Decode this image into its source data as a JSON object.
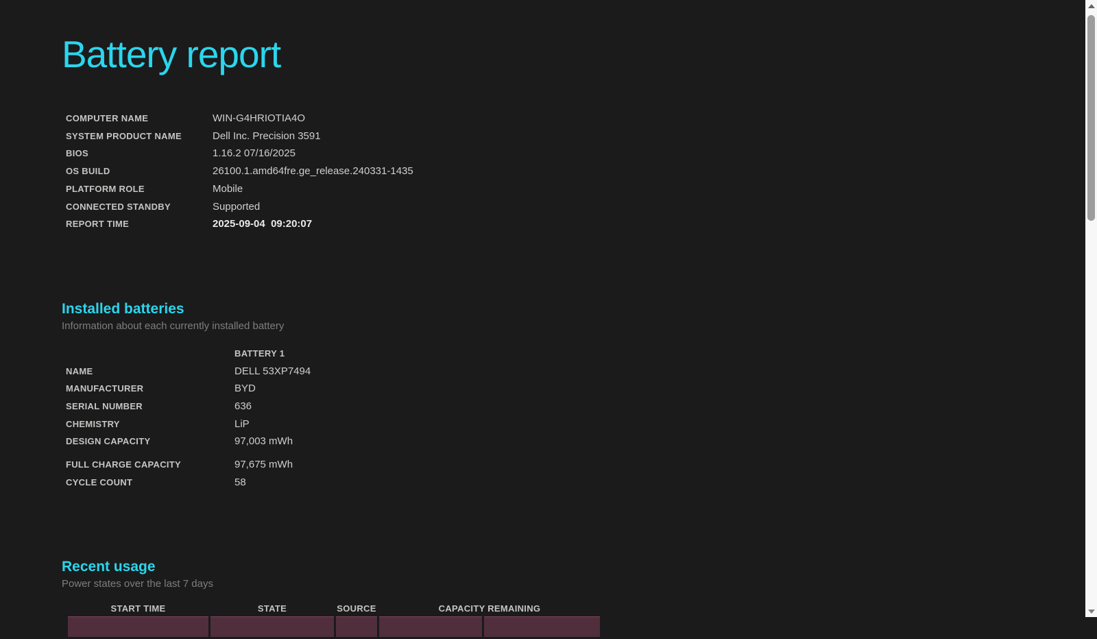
{
  "colors": {
    "background": "#1b1b1c",
    "accent": "#2bd6ed",
    "label_text": "#c6c5c2",
    "value_text": "#d0cfcc",
    "muted_text": "#7e7e7e",
    "usage_row_highlight": "#512e3b",
    "scrollbar_track": "#f7f7f7",
    "scrollbar_thumb": "#9d9d9d"
  },
  "title": "Battery report",
  "system_info": {
    "rows": [
      {
        "label": "COMPUTER NAME",
        "value": "WIN-G4HRIOTIA4O"
      },
      {
        "label": "SYSTEM PRODUCT NAME",
        "value": "Dell Inc. Precision 3591"
      },
      {
        "label": "BIOS",
        "value": "1.16.2 07/16/2025"
      },
      {
        "label": "OS BUILD",
        "value": "26100.1.amd64fre.ge_release.240331-1435"
      },
      {
        "label": "PLATFORM ROLE",
        "value": "Mobile"
      },
      {
        "label": "CONNECTED STANDBY",
        "value": "Supported"
      },
      {
        "label": "REPORT TIME",
        "value": "2025-09-04  09:20:07"
      }
    ]
  },
  "installed_batteries": {
    "heading": "Installed batteries",
    "subtitle": "Information about each currently installed battery",
    "column_header": "BATTERY 1",
    "details": [
      {
        "label": "NAME",
        "value": "DELL 53XP7494"
      },
      {
        "label": "MANUFACTURER",
        "value": "BYD"
      },
      {
        "label": "SERIAL NUMBER",
        "value": "636"
      },
      {
        "label": "CHEMISTRY",
        "value": "LiP"
      },
      {
        "label": "DESIGN CAPACITY",
        "value": "97,003 mWh"
      }
    ],
    "capacity": [
      {
        "label": "FULL CHARGE CAPACITY",
        "value": "97,675 mWh"
      },
      {
        "label": "CYCLE COUNT",
        "value": "58"
      }
    ]
  },
  "recent_usage": {
    "heading": "Recent usage",
    "subtitle": "Power states over the last 7 days",
    "columns": [
      "START TIME",
      "STATE",
      "SOURCE",
      "CAPACITY REMAINING"
    ]
  }
}
